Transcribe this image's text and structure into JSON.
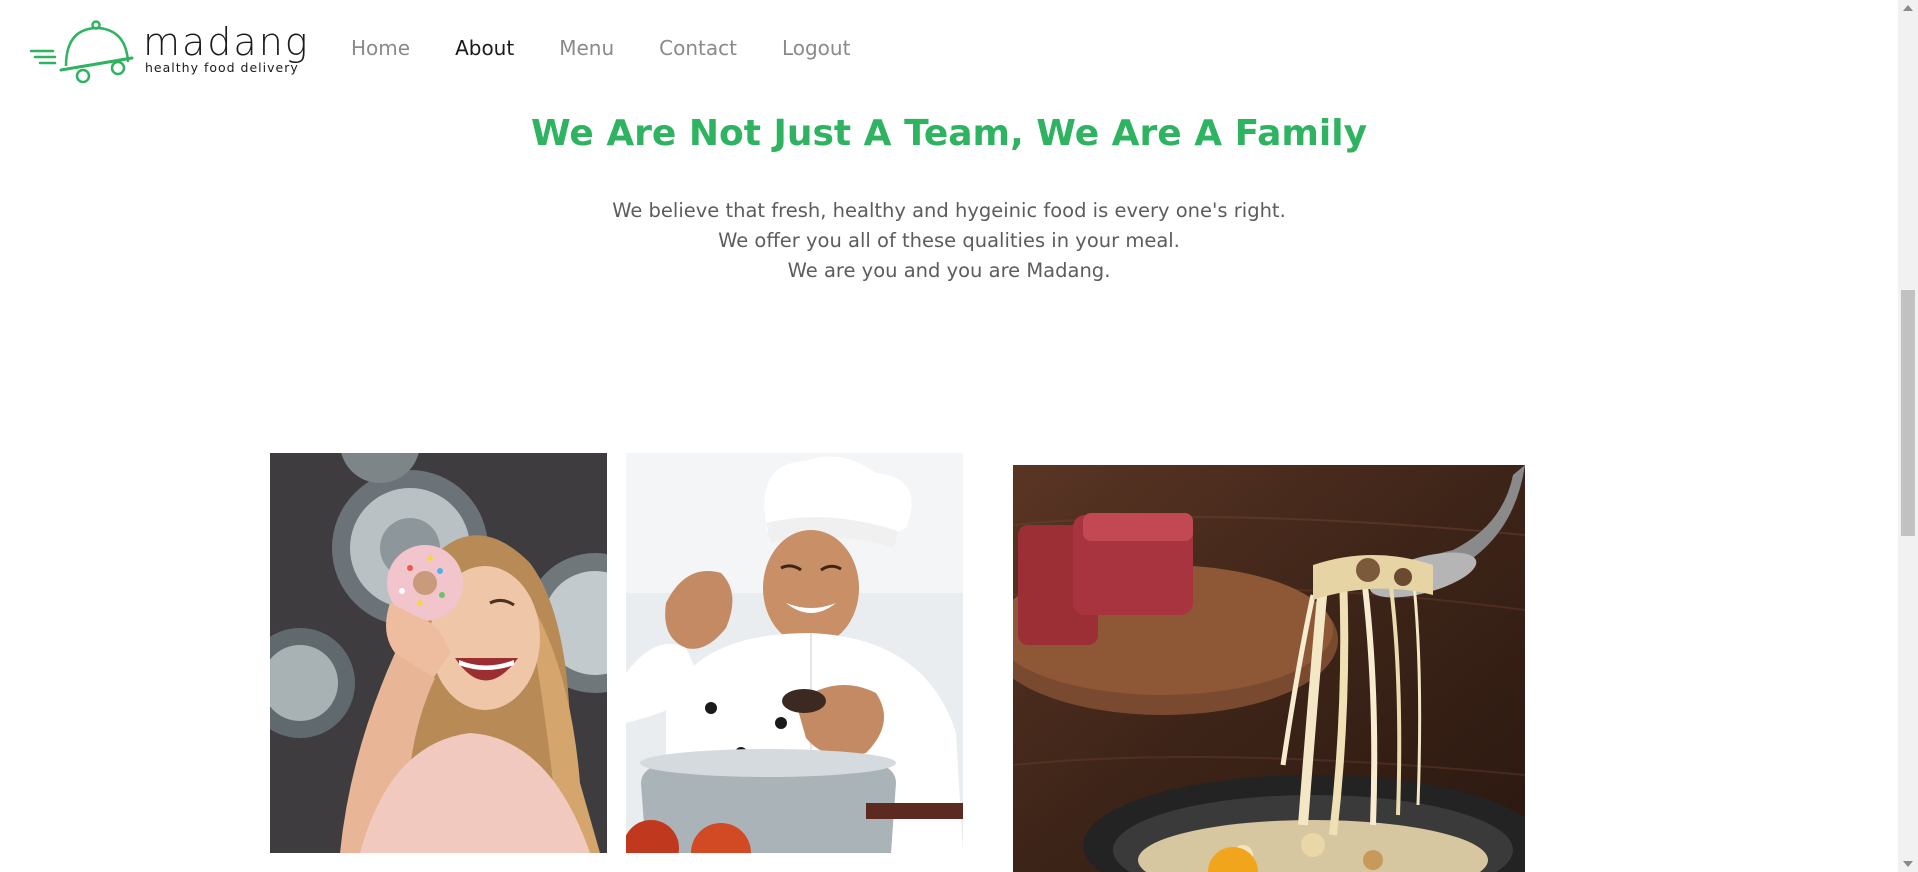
{
  "brand": {
    "name": "madang",
    "tagline": "healthy food delivery",
    "accent_color": "#2eb361"
  },
  "nav": {
    "items": [
      {
        "label": "Home",
        "active": false
      },
      {
        "label": "About",
        "active": true
      },
      {
        "label": "Menu",
        "active": false
      },
      {
        "label": "Contact",
        "active": false
      },
      {
        "label": "Logout",
        "active": false
      }
    ]
  },
  "hero": {
    "title": "We Are Not Just A Team, We Are A Family",
    "lines": [
      "We believe that fresh, healthy and hygeinic food is every one's right.",
      "We offer you all of these qualities in your meal.",
      "We are you and you are Madang."
    ]
  },
  "photos": [
    {
      "subject": "woman-with-donut-photo"
    },
    {
      "subject": "chef-seasoning-pot-photo"
    },
    {
      "subject": "cheese-noodle-bowl-photo"
    }
  ],
  "icons": {
    "logo": "delivery-cloche-icon"
  }
}
